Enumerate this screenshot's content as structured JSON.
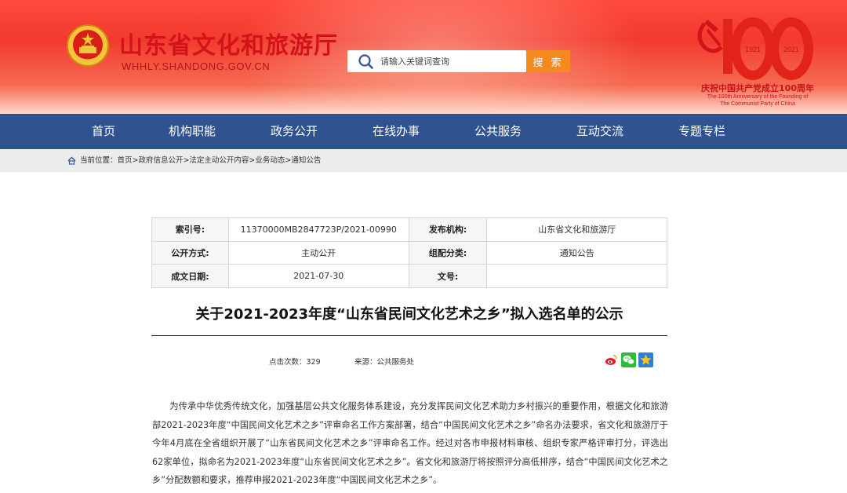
{
  "header": {
    "site_title": "山东省文化和旅游厅",
    "site_domain": "WHHLY.SHANDONG.GOV.CN",
    "search_placeholder": "请输入关键词查询",
    "search_button": "搜 索",
    "anniversary": {
      "year_left": "1921",
      "year_right": "2021",
      "number": "100",
      "slogan_cn": "庆祝中国共产党成立100周年",
      "slogan_en_line1": "The 100th Anniversary of the Founding of",
      "slogan_en_line2": "The Communist Party of China"
    }
  },
  "nav": {
    "items": [
      "首页",
      "机构职能",
      "政务公开",
      "在线办事",
      "公共服务",
      "互动交流",
      "专题专栏"
    ]
  },
  "breadcrumb": {
    "label": "当前位置：",
    "path": "首页>政府信息公开>法定主动公开内容>业务动态>通知公告"
  },
  "info_table": {
    "index_label": "索引号:",
    "index_value": "11370000MB2847723P/2021-00990",
    "publisher_label": "发布机构:",
    "publisher_value": "山东省文化和旅游厅",
    "disclosure_label": "公开方式:",
    "disclosure_value": "主动公开",
    "category_label": "组配分类:",
    "category_value": "通知公告",
    "date_label": "成文日期:",
    "date_value": "2021-07-30",
    "doc_no_label": "文号:",
    "doc_no_value": ""
  },
  "article": {
    "title": "关于2021-2023年度“山东省民间文化艺术之乡”拟入选名单的公示",
    "views_label": "点击次数：",
    "views_value": "329",
    "source_label": "来源：",
    "source_value": "公共服务处",
    "body": "为传承中华优秀传统文化，加强基层公共文化服务体系建设，充分发挥民间文化艺术助力乡村振兴的重要作用，根据文化和旅游部2021-2023年度“中国民间文化艺术之乡”评审命名工作方案部署，结合“中国民间文化艺术之乡”命名办法要求，省文化和旅游厅于今年4月底在全省组织开展了“山东省民间文化艺术之乡”评审命名工作。经过对各市申报材料审核、组织专家严格评审打分，评选出62家单位，拟命名为2021-2023年度“山东省民间文化艺术之乡”。省文化和旅游厅将按照评分高低排序，结合“中国民间文化艺术之乡”分配数额和要求，推荐申报2021-2023年度“中国民间文化艺术之乡”。"
  },
  "share_icons": [
    "weibo-icon",
    "wechat-icon",
    "qzone-icon"
  ],
  "colors": {
    "header_red": "#f23a2e",
    "nav_blue": "#30528f",
    "search_orange": "#f58a1f",
    "title_red": "#d4121a"
  }
}
